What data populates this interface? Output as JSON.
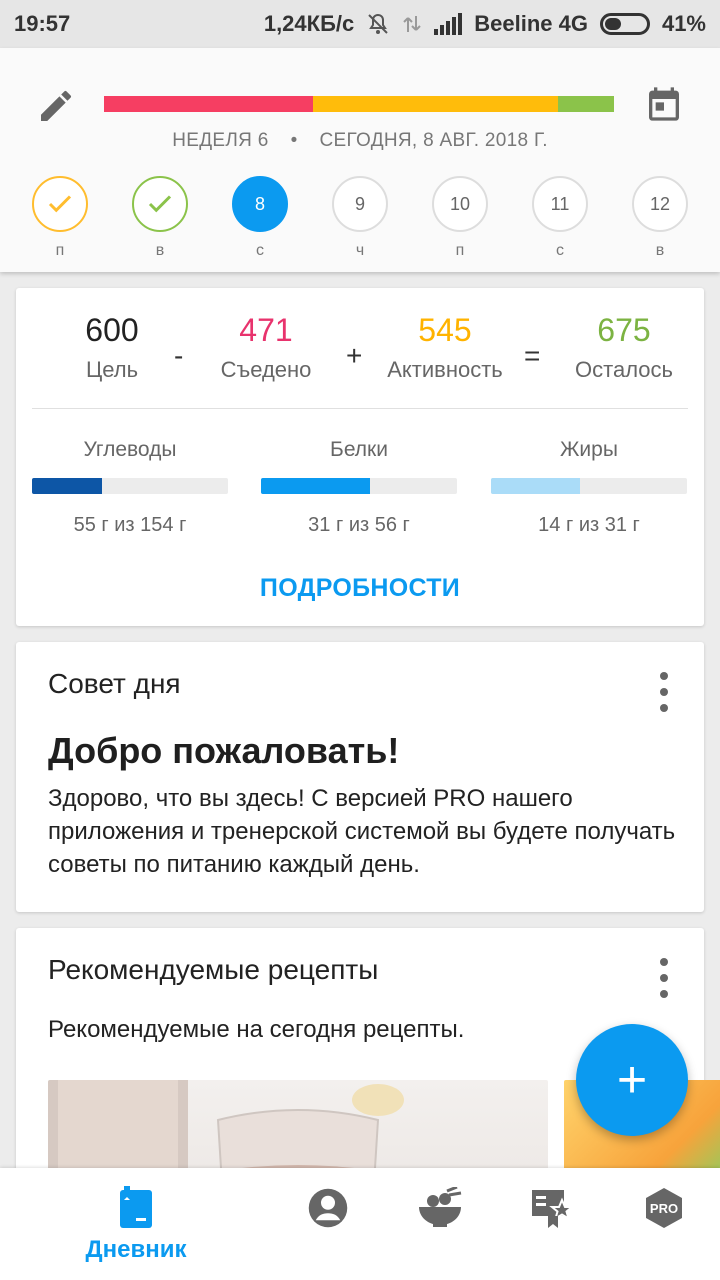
{
  "status_bar": {
    "time": "19:57",
    "speed": "1,24КБ/с",
    "carrier": "Beeline 4G",
    "battery_percent": "41%",
    "battery_level": 0.41
  },
  "header": {
    "week": "НЕДЕЛЯ 6",
    "separator": "•",
    "date": "СЕГОДНЯ, 8 АВГ. 2018 Г.",
    "progress_segments": [
      {
        "color": "#f63e62",
        "fraction": 0.41
      },
      {
        "color": "#ffbc0b",
        "fraction": 0.48
      },
      {
        "color": "#8bc34a",
        "fraction": 0.11
      }
    ],
    "days": [
      {
        "num": "",
        "label": "п",
        "state": "yellow",
        "icon": "check-icon"
      },
      {
        "num": "",
        "label": "в",
        "state": "green",
        "icon": "check-icon"
      },
      {
        "num": "8",
        "label": "с",
        "state": "active"
      },
      {
        "num": "9",
        "label": "ч",
        "state": "future"
      },
      {
        "num": "10",
        "label": "п",
        "state": "future"
      },
      {
        "num": "11",
        "label": "с",
        "state": "future"
      },
      {
        "num": "12",
        "label": "в",
        "state": "future"
      }
    ]
  },
  "calories": {
    "goal": {
      "value": "600",
      "label": "Цель",
      "color": "#222222"
    },
    "minus": "-",
    "eaten": {
      "value": "471",
      "label": "Съедено",
      "color": "#e8336d"
    },
    "plus": "+",
    "activity": {
      "value": "545",
      "label": "Активность",
      "color": "#ffb300"
    },
    "equals": "=",
    "remaining": {
      "value": "675",
      "label": "Осталось",
      "color": "#7cb342"
    }
  },
  "macros": [
    {
      "name": "Углеводы",
      "value": "55 г из 154 г",
      "fraction": 0.357,
      "color": "#0d56a6"
    },
    {
      "name": "Белки",
      "value": "31 г из 56 г",
      "fraction": 0.554,
      "color": "#0b9af0"
    },
    {
      "name": "Жиры",
      "value": "14 г из 31 г",
      "fraction": 0.452,
      "color": "#aadcf8"
    }
  ],
  "details_label": "ПОДРОБНОСТИ",
  "tip": {
    "title": "Совет дня",
    "heading": "Добро пожаловать!",
    "body": "Здорово, что вы здесь! С версией PRO нашего приложения и тренерской системой вы будете получать советы по питанию каждый день."
  },
  "recipes": {
    "title": "Рекомендуемые рецепты",
    "subtitle": "Рекомендуемые на сегодня рецепты."
  },
  "fab": {
    "symbol": "+"
  },
  "bottom_nav": {
    "diary_label": "Дневник",
    "pro_text": "PRO",
    "accent": "#0b9af0",
    "icons": [
      "diary-icon",
      "profile-icon",
      "recipes-icon",
      "plans-icon",
      "pro-icon"
    ]
  }
}
